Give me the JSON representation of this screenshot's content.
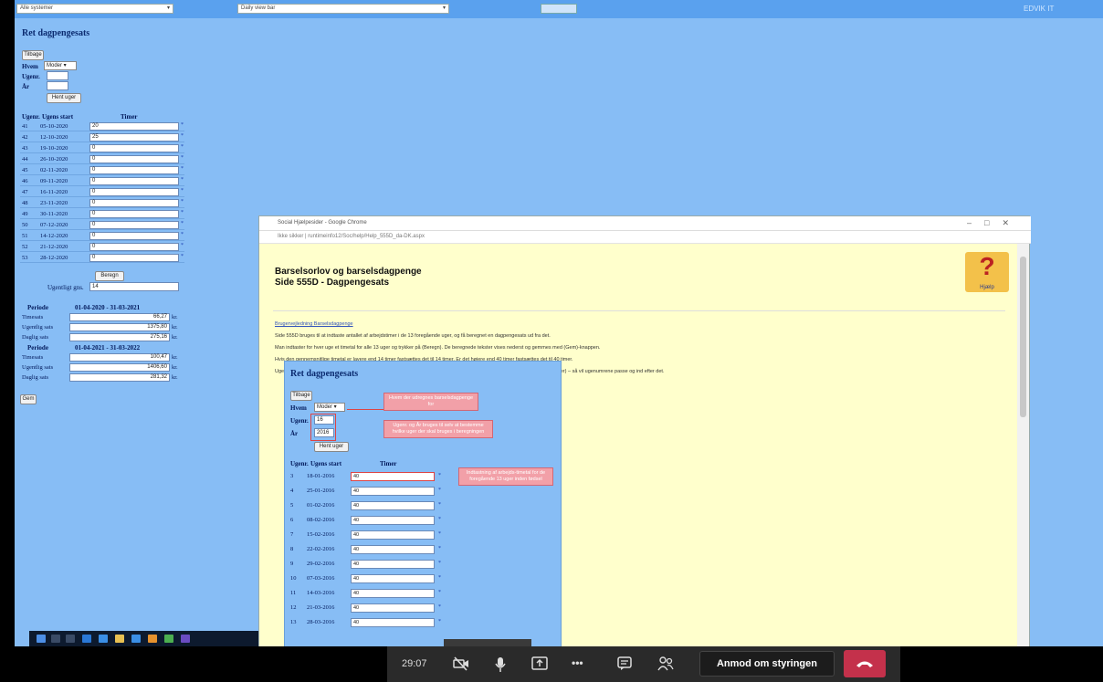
{
  "topbar": {
    "select1": "Alle systemer",
    "select2": "Daily view bar",
    "user": "EDVIK IT"
  },
  "left": {
    "title": "Ret dagpengesats",
    "back_button": "Tilbage",
    "hvem_label": "Hvem",
    "hvem_value": "Moder",
    "ugenr_label": "Ugenr.",
    "ar_label": "År",
    "fetch_button": "Hent uger",
    "table_headers": [
      "Ugenr.",
      "Ugens start",
      "Timer"
    ],
    "weeks": [
      {
        "nr": "41",
        "start": "05-10-2020",
        "hours": "20"
      },
      {
        "nr": "42",
        "start": "12-10-2020",
        "hours": "25"
      },
      {
        "nr": "43",
        "start": "19-10-2020",
        "hours": "0"
      },
      {
        "nr": "44",
        "start": "26-10-2020",
        "hours": "0"
      },
      {
        "nr": "45",
        "start": "02-11-2020",
        "hours": "0"
      },
      {
        "nr": "46",
        "start": "09-11-2020",
        "hours": "0"
      },
      {
        "nr": "47",
        "start": "16-11-2020",
        "hours": "0"
      },
      {
        "nr": "48",
        "start": "23-11-2020",
        "hours": "0"
      },
      {
        "nr": "49",
        "start": "30-11-2020",
        "hours": "0"
      },
      {
        "nr": "50",
        "start": "07-12-2020",
        "hours": "0"
      },
      {
        "nr": "51",
        "start": "14-12-2020",
        "hours": "0"
      },
      {
        "nr": "52",
        "start": "21-12-2020",
        "hours": "0"
      },
      {
        "nr": "53",
        "start": "28-12-2020",
        "hours": "0"
      }
    ],
    "calc_button": "Beregn",
    "avg_label": "Ugentligt gns.",
    "avg_value": "14",
    "periods": [
      {
        "label": "Periode",
        "range": "01-04-2020 - 31-03-2021",
        "rows": [
          {
            "label": "Timesats",
            "value": "66,27",
            "unit": "kr."
          },
          {
            "label": "Ugentlig sats",
            "value": "1375,80",
            "unit": "kr."
          },
          {
            "label": "Daglig sats",
            "value": "275,16",
            "unit": "kr."
          }
        ]
      },
      {
        "label": "Periode",
        "range": "01-04-2021 - 31-03-2022",
        "rows": [
          {
            "label": "Timesats",
            "value": "100,47",
            "unit": "kr."
          },
          {
            "label": "Ugentlig sats",
            "value": "1406,60",
            "unit": "kr."
          },
          {
            "label": "Daglig sats",
            "value": "281,32",
            "unit": "kr."
          }
        ]
      }
    ],
    "save_button": "Gem"
  },
  "chrome": {
    "title": "Social Hjælpesider - Google Chrome",
    "address": "Ikke sikker | runtimeinfo12/Soc/help/Help_555D_da-DK.aspx",
    "heading1": "Barselsorlov og barselsdagpenge",
    "heading2": "Side 555D - Dagpengesats",
    "help_label": "Hjælp",
    "guide_link": "Brugervejledning Barselsdagpenge",
    "paragraphs": [
      "Side 555D bruges til at indtaste antallet af arbejdstimer i de 13 foregående uger, og få beregnet en dagpengesats ud fra det.",
      "Man indtaster for hver uge et timetal for alle 13 uger og trykker på (Beregn). De beregnede tekster vises nederst og gemmes med (Gem)-knappen.",
      "Hvis den gennemsnitlige timetal er lavere end 14 timer fastsættes det til 14 timer. Er det højere end 40 timer fastsættes det til 40 timer.",
      "Ugenumrene foreslås automatisk. Hvis man ikke synes at de passer kan man indtaste et ugenummer og et år og trykke (Hent uger) – så vil ugenumrene passe og ind efter det."
    ],
    "inner": {
      "title": "Ret dagpengesats",
      "back_button": "Tilbage",
      "hvem_label": "Hvem",
      "hvem_value": "Moder",
      "ugenr_label": "Ugenr.",
      "ugenr_value": "16",
      "ar_label": "År",
      "ar_value": "2016",
      "fetch_button": "Hent uger",
      "table_headers": [
        "Ugenr.",
        "Ugens start",
        "Timer"
      ],
      "weeks": [
        {
          "nr": "3",
          "start": "18-01-2016",
          "hours": "40"
        },
        {
          "nr": "4",
          "start": "25-01-2016",
          "hours": "40"
        },
        {
          "nr": "5",
          "start": "01-02-2016",
          "hours": "40"
        },
        {
          "nr": "6",
          "start": "08-02-2016",
          "hours": "40"
        },
        {
          "nr": "7",
          "start": "15-02-2016",
          "hours": "40"
        },
        {
          "nr": "8",
          "start": "22-02-2016",
          "hours": "40"
        },
        {
          "nr": "9",
          "start": "29-02-2016",
          "hours": "40"
        },
        {
          "nr": "10",
          "start": "07-03-2016",
          "hours": "40"
        },
        {
          "nr": "11",
          "start": "14-03-2016",
          "hours": "40"
        },
        {
          "nr": "12",
          "start": "21-03-2016",
          "hours": "40"
        },
        {
          "nr": "13",
          "start": "28-03-2016",
          "hours": "40"
        }
      ],
      "annotations": {
        "who": "Hvem der udregnes barselsdagpenge for",
        "week_year": "Ugenr. og År bruges til selv at bestemme hvilke uger der skal bruges i beregningen",
        "hours": "Indtastning af arbejds-timetal for de foregående 13 uger inden fødsel"
      }
    }
  },
  "teams": {
    "time": "29:07",
    "request_control": "Anmod om styringen",
    "icons": [
      "camera-off-icon",
      "microphone-icon",
      "share-screen-icon",
      "more-icon",
      "chat-icon",
      "participants-icon",
      "hang-up-icon"
    ]
  },
  "colors": {
    "page_bg": "#87bdf5",
    "help_bg": "#ffffcc",
    "annotation": "#f2a0a8",
    "hangup": "#c4314b"
  }
}
